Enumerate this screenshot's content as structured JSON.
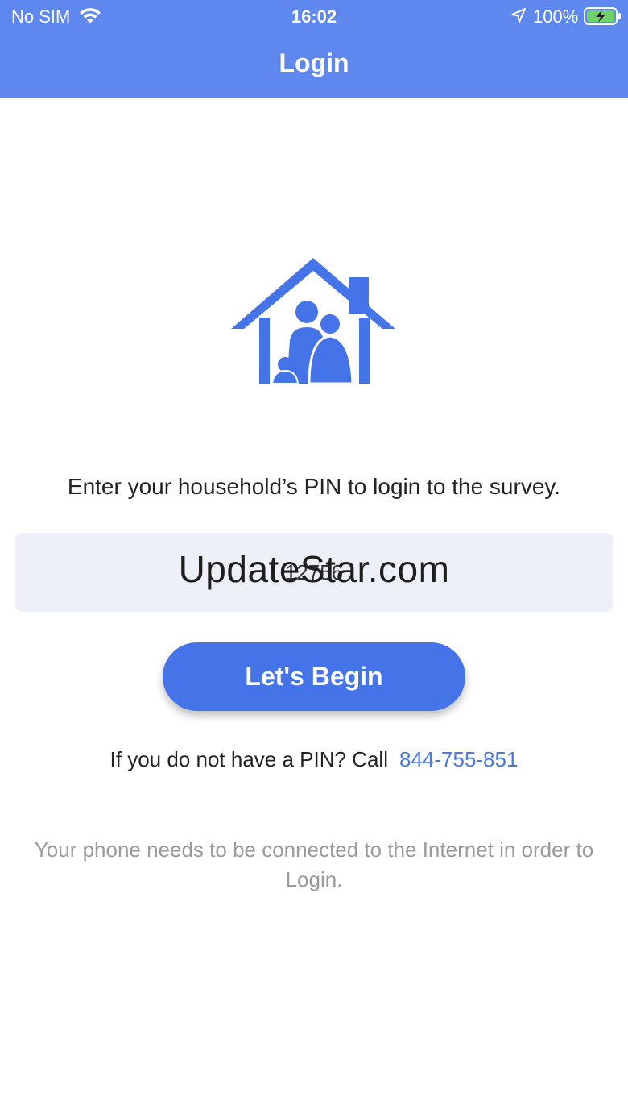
{
  "status_bar": {
    "carrier": "No SIM",
    "time": "16:02",
    "battery_percent": "100%",
    "icons": [
      "wifi-icon",
      "location-arrow-icon",
      "battery-charging-icon"
    ]
  },
  "header": {
    "title": "Login",
    "background_color": "#5e88ee"
  },
  "logo": {
    "icon": "house-family-icon",
    "color": "#4573e8"
  },
  "login": {
    "prompt": "Enter your household’s PIN to login to the survey.",
    "pin_value": "12756",
    "watermark": "UpdateStar.com",
    "begin_button_label": "Let's Begin",
    "help_text": "If you do not have a PIN? Call",
    "help_phone": "844-755-851",
    "notice": "Your phone needs to be connected to the Internet in order to Login."
  },
  "colors": {
    "accent": "#4573e8",
    "link": "#4a78e6",
    "field_background": "#edf0f7",
    "notice_text": "#9a9a9a"
  }
}
